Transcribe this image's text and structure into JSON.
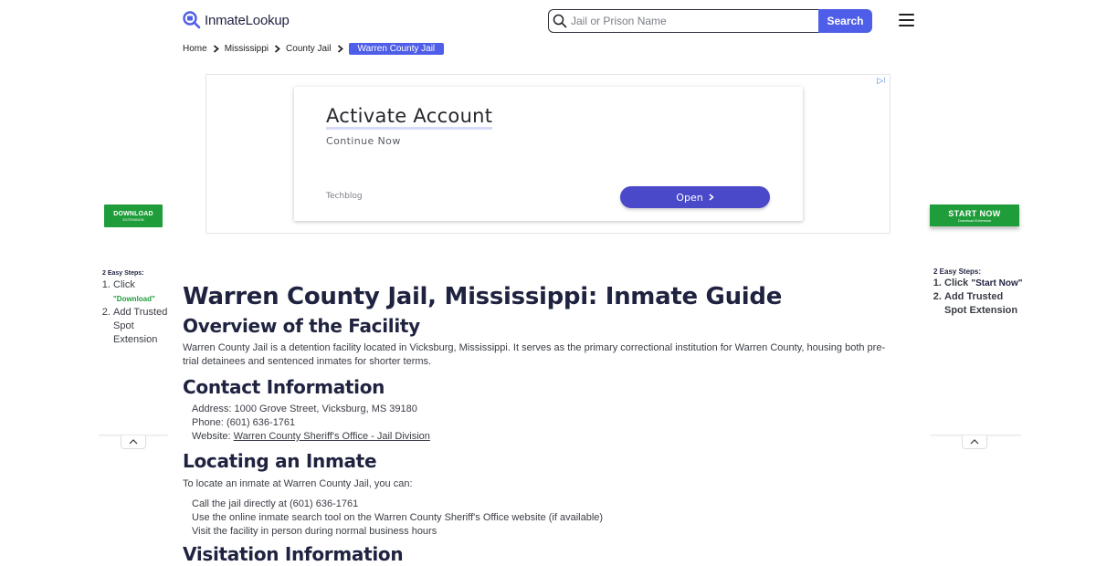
{
  "header": {
    "logo_text": "InmateLookup",
    "search_placeholder": "Jail or Prison Name",
    "search_button": "Search"
  },
  "breadcrumb": [
    {
      "label": "Home"
    },
    {
      "label": "Mississippi"
    },
    {
      "label": "County Jail"
    },
    {
      "label": "Warren County Jail"
    }
  ],
  "ad": {
    "title": "Activate Account",
    "subtitle": "Continue Now",
    "brand": "Techblog",
    "button": "Open",
    "badge": "▷⁝"
  },
  "side_left": {
    "button_main": "DOWNLOAD",
    "button_sub": "EXTENSION",
    "steps_title": "2 Easy Steps:",
    "step1_prefix": "Click",
    "step1_highlight": "\"Download\"",
    "step2": "Add Trusted Spot Extension"
  },
  "side_right": {
    "button_main": "START NOW",
    "button_sub": "Download Extension",
    "steps_title": "2 Easy Steps:",
    "step1_prefix": "Click",
    "step1_highlight": "\"Start Now\"",
    "step2": "Add Trusted Spot Extension"
  },
  "main": {
    "title": "Warren County Jail, Mississippi: Inmate Guide",
    "overview_heading": "Overview of the Facility",
    "overview_text": "Warren County Jail is a detention facility located in Vicksburg, Mississippi. It serves as the primary correctional institution for Warren County, housing both pre-trial detainees and sentenced inmates for shorter terms.",
    "contact_heading": "Contact Information",
    "contact": {
      "address_label": "Address:",
      "address": "1000 Grove Street, Vicksburg, MS 39180",
      "phone_label": "Phone:",
      "phone": "(601) 636-1761",
      "website_label": "Website:",
      "website": "Warren County Sheriff's Office - Jail Division"
    },
    "locating_heading": "Locating an Inmate",
    "locating_intro": "To locate an inmate at Warren County Jail, you can:",
    "locating_steps": [
      "Call the jail directly at (601) 636-1761",
      "Use the online inmate search tool on the Warren County Sheriff's Office website (if available)",
      "Visit the facility in person during normal business hours"
    ],
    "visitation_heading": "Visitation Information"
  }
}
